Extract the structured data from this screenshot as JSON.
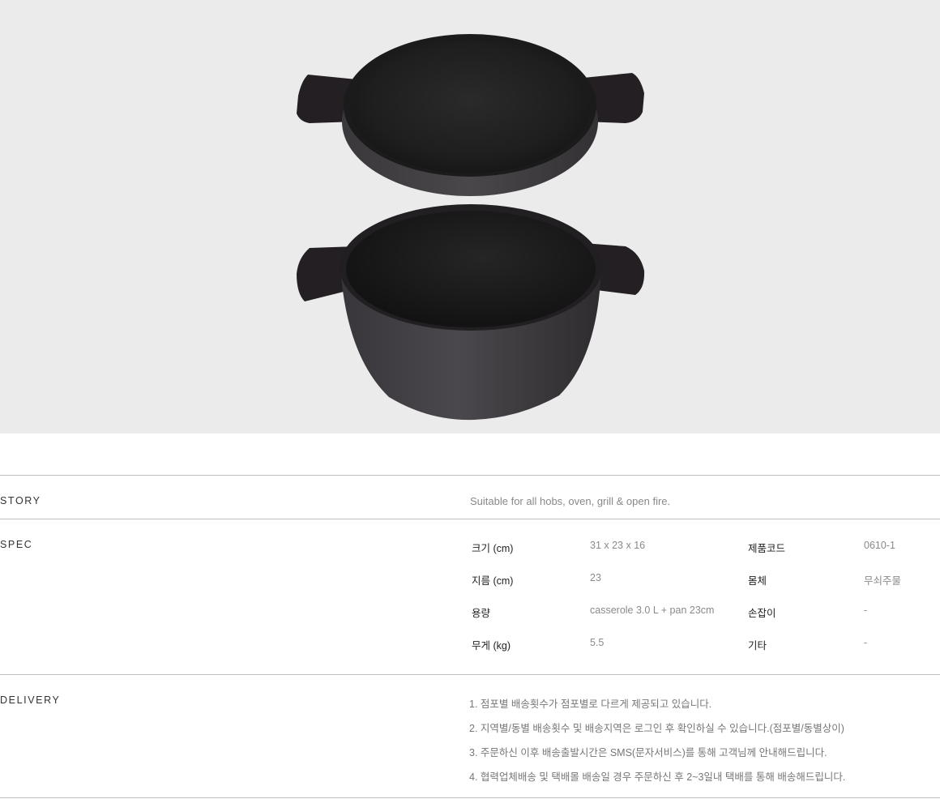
{
  "hero": {
    "image_name": "cast-iron-casserole-and-pan",
    "background": "#ebebeb",
    "iron_color": "#2a2829"
  },
  "story": {
    "title": "STORY",
    "text": "Suitable for all hobs, oven, grill & open fire."
  },
  "spec": {
    "title": "SPEC",
    "rows": [
      {
        "label1": "크기 (cm)",
        "value1": "31 x 23 x 16",
        "label2": "제품코드",
        "value2": "0610-1"
      },
      {
        "label1": "지름 (cm)",
        "value1": "23",
        "label2": "몸체",
        "value2": "무쇠주물"
      },
      {
        "label1": "용량",
        "value1": "casserole 3.0 L + pan 23cm",
        "label2": "손잡이",
        "value2": "-"
      },
      {
        "label1": "무게 (kg)",
        "value1": "5.5",
        "label2": "기타",
        "value2": "-"
      }
    ]
  },
  "delivery": {
    "title": "DELIVERY",
    "lines": [
      "1. 점포별 배송횟수가 점포별로 다르게 제공되고 있습니다.",
      "2. 지역별/동별 배송횟수 및 배송지역은 로그인 후 확인하실 수 있습니다.(점포별/동별상이)",
      "3. 주문하신 이후 배송출발시간은 SMS(문자서비스)를 통해 고객님께 안내해드립니다.",
      "4. 협력업체배송 및 택배몰 배송일 경우 주문하신 후 2~3일내 택배를 통해 배송해드립니다."
    ]
  }
}
